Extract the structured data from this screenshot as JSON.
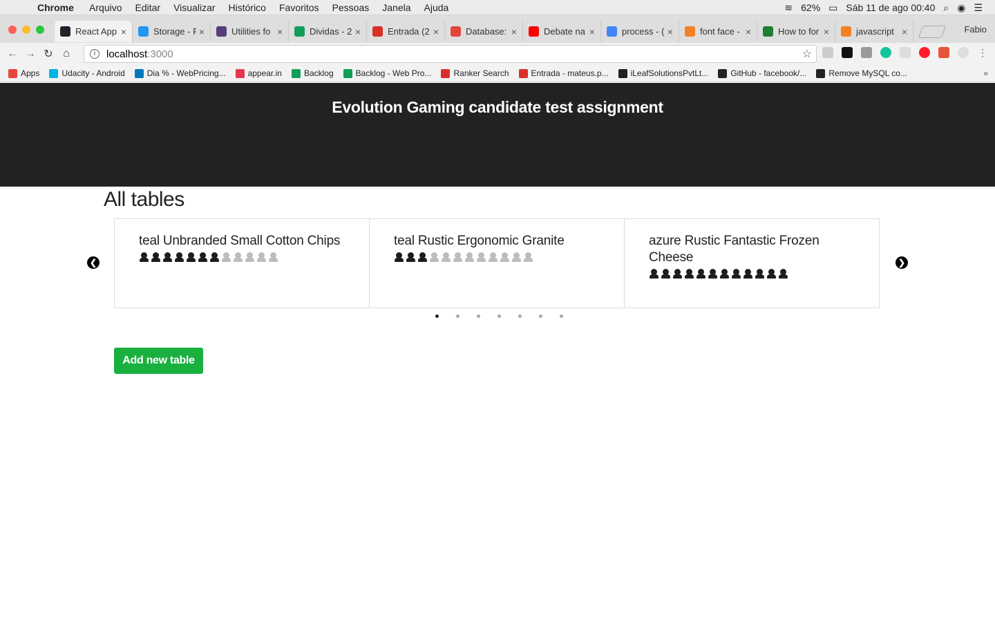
{
  "colors": {
    "header_bg": "#222222",
    "add_button": "#1ab040",
    "seat_occupied": "#1d1d1d",
    "seat_free": "#bdbdbd",
    "dot_active": "#222222",
    "dot_inactive": "#aaaaaa"
  },
  "mac_menu": {
    "app_name": "Chrome",
    "items": [
      "Arquivo",
      "Editar",
      "Visualizar",
      "Histórico",
      "Favoritos",
      "Pessoas",
      "Janela",
      "Ajuda"
    ],
    "battery": "62%",
    "clock": "Sáb 11 de ago  00:40"
  },
  "browser": {
    "tabs": [
      {
        "title": "React App",
        "icon": "react-icon",
        "color": "#20232a",
        "active": true
      },
      {
        "title": "Storage - F",
        "icon": "storage-icon",
        "color": "#2196f3",
        "active": false
      },
      {
        "title": "Utilities fo",
        "icon": "bootstrap-icon",
        "color": "#563d7c",
        "active": false
      },
      {
        "title": "Dividas - 2",
        "icon": "sheets-icon",
        "color": "#0f9d58",
        "active": false
      },
      {
        "title": "Entrada (2",
        "icon": "gmail-icon",
        "color": "#d93025",
        "active": false
      },
      {
        "title": "Database:",
        "icon": "database-icon",
        "color": "#e2463b",
        "active": false
      },
      {
        "title": "Debate na",
        "icon": "youtube-icon",
        "color": "#ff0000",
        "active": false
      },
      {
        "title": "process - (",
        "icon": "google-icon",
        "color": "#4285f4",
        "active": false
      },
      {
        "title": "font face -",
        "icon": "stackoverflow-icon",
        "color": "#f48024",
        "active": false
      },
      {
        "title": "How to for",
        "icon": "sheets-icon",
        "color": "#1e7e34",
        "active": false
      },
      {
        "title": "javascript",
        "icon": "stackoverflow-icon",
        "color": "#f48024",
        "active": false
      }
    ],
    "profile": "Fabio",
    "url_host": "localhost",
    "url_port": ":3000",
    "bookmarks": [
      {
        "label": "Apps",
        "icon": "apps-icon",
        "color": "#e8453c"
      },
      {
        "label": "Udacity - Android",
        "icon": "udacity-icon",
        "color": "#02b3e4"
      },
      {
        "label": "Dia % - WebPricing...",
        "icon": "trello-icon",
        "color": "#0079bf"
      },
      {
        "label": "appear.in",
        "icon": "appear-icon",
        "color": "#e8344e"
      },
      {
        "label": "Backlog",
        "icon": "sheets-icon",
        "color": "#0f9d58"
      },
      {
        "label": "Backlog - Web Pro...",
        "icon": "sheets-icon",
        "color": "#0f9d58"
      },
      {
        "label": "Ranker Search",
        "icon": "ranker-icon",
        "color": "#d62e2e"
      },
      {
        "label": "Entrada - mateus.p...",
        "icon": "gmail-icon",
        "color": "#d93025"
      },
      {
        "label": "iLeafSolutionsPvtLt...",
        "icon": "github-icon",
        "color": "#222222"
      },
      {
        "label": "GitHub - facebook/...",
        "icon": "github-icon",
        "color": "#222222"
      },
      {
        "label": "Remove MySQL co...",
        "icon": "github-icon",
        "color": "#222222"
      }
    ]
  },
  "page": {
    "header_title": "Evolution Gaming candidate test assignment",
    "section_title": "All tables",
    "add_button_label": "Add new table",
    "carousel": {
      "cards": [
        {
          "name": "teal Unbranded Small Cotton Chips",
          "seats_occupied": 7,
          "seats_total": 12
        },
        {
          "name": "teal Rustic Ergonomic Granite",
          "seats_occupied": 3,
          "seats_total": 12
        },
        {
          "name": "azure Rustic Fantastic Frozen Cheese",
          "seats_occupied": 12,
          "seats_total": 12
        }
      ],
      "page_count": 7,
      "active_page": 0
    }
  }
}
